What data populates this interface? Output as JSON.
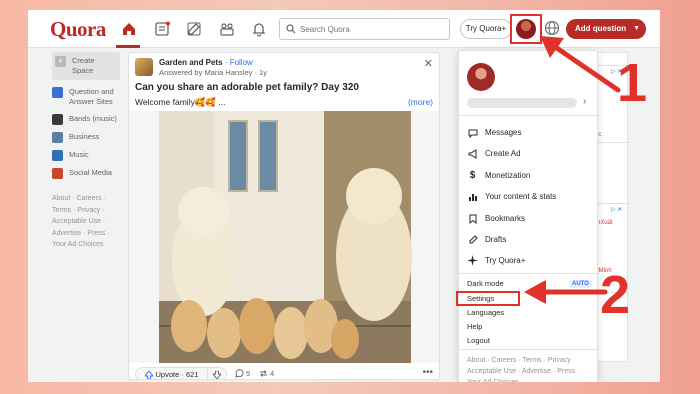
{
  "app": {
    "logo": "Quora"
  },
  "search": {
    "placeholder": "Search Quora"
  },
  "topbar": {
    "try_quora_plus": "Try Quora+",
    "add_question": "Add question"
  },
  "sidebar": {
    "items": [
      {
        "label": "Create Space",
        "color": "#b7b8b9"
      },
      {
        "label": "Question and Answer Sites",
        "color": "#3b6fd1"
      },
      {
        "label": "Bands (music)",
        "color": "#3a3a3a"
      },
      {
        "label": "Business",
        "color": "#5b7ea7"
      },
      {
        "label": "Music",
        "color": "#2f6fb3"
      },
      {
        "label": "Social Media",
        "color": "#c8462c"
      }
    ],
    "footer": "About · Careers · Terms · Privacy · Acceptable Use · Advertise · Press · Your Ad Choices"
  },
  "post": {
    "space_name": "Garden and Pets",
    "follow": " · Follow",
    "answered_by": "Answered by Maria Hansley · 1y",
    "question": "Can you share an adorable pet family? Day 320",
    "body": "Welcome family🥰🥰 ...",
    "more": "(more)",
    "upvote": "Upvote · 621",
    "comments": "5",
    "shares": "4"
  },
  "menu": {
    "items": [
      {
        "label": "Messages",
        "icon": "messages-icon"
      },
      {
        "label": "Create Ad",
        "icon": "megaphone-icon"
      },
      {
        "label": "Monetization",
        "icon": "dollar-icon"
      },
      {
        "label": "Your content & stats",
        "icon": "stats-icon"
      },
      {
        "label": "Bookmarks",
        "icon": "bookmark-icon"
      },
      {
        "label": "Drafts",
        "icon": "drafts-icon"
      },
      {
        "label": "Try Quora+",
        "icon": "sparkle-icon"
      }
    ],
    "dark_mode": "Dark mode",
    "dark_mode_value": "AUTO",
    "settings": "Settings",
    "languages": "Languages",
    "help": "Help",
    "logout": "Logout",
    "footer": "About · Careers · Terms · Privacy · Acceptable Use · Advertise · Press · Your Ad Choices"
  },
  "ads": {
    "text1": "ic",
    "text2": "nXuất",
    "text3": "ìMinh"
  },
  "annotations": {
    "step1": "1",
    "step2": "2",
    "color": "#e0312b"
  }
}
